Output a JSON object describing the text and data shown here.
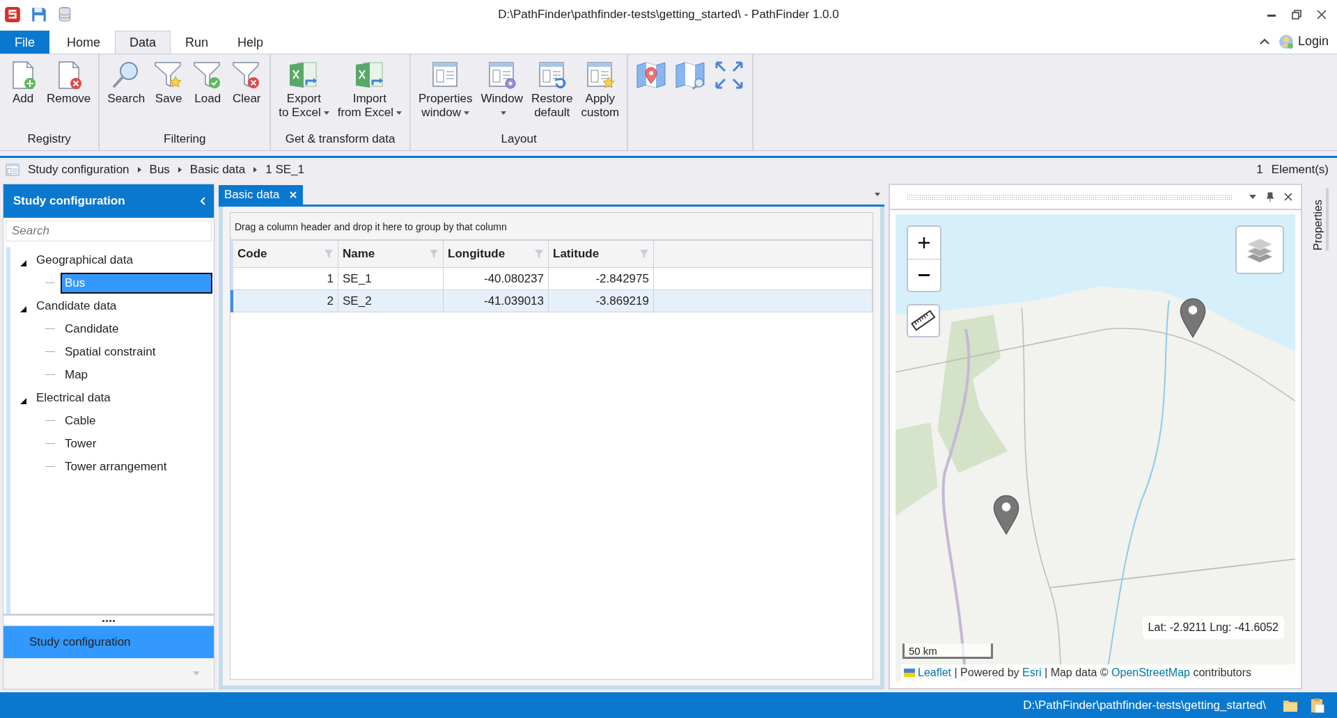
{
  "window": {
    "title": "D:\\PathFinder\\pathfinder-tests\\getting_started\\ - PathFinder 1.0.0"
  },
  "ribbon_tabs": [
    {
      "label": "File",
      "kind": "file",
      "selected": false
    },
    {
      "label": "Home",
      "kind": "tab",
      "selected": false
    },
    {
      "label": "Data",
      "kind": "tab",
      "selected": true
    },
    {
      "label": "Run",
      "kind": "tab",
      "selected": false
    },
    {
      "label": "Help",
      "kind": "tab",
      "selected": false
    }
  ],
  "login": "Login",
  "ribbon_groups": [
    {
      "label": "Registry",
      "buttons": [
        {
          "kind": "add",
          "lines": [
            "Add"
          ],
          "dropdown": false
        },
        {
          "kind": "remove",
          "lines": [
            "Remove"
          ],
          "dropdown": false
        }
      ]
    },
    {
      "label": "Filtering",
      "buttons": [
        {
          "kind": "search",
          "lines": [
            "Search"
          ],
          "dropdown": false
        },
        {
          "kind": "filter-save",
          "lines": [
            "Save"
          ],
          "dropdown": false
        },
        {
          "kind": "filter-load",
          "lines": [
            "Load"
          ],
          "dropdown": false
        },
        {
          "kind": "filter-clear",
          "lines": [
            "Clear"
          ],
          "dropdown": false
        }
      ]
    },
    {
      "label": "Get & transform data",
      "buttons": [
        {
          "kind": "export",
          "lines": [
            "Export",
            "to Excel"
          ],
          "dropdown": true
        },
        {
          "kind": "import",
          "lines": [
            "Import",
            "from Excel"
          ],
          "dropdown": true
        }
      ]
    },
    {
      "label": "Layout",
      "buttons": [
        {
          "kind": "properties",
          "lines": [
            "Properties",
            "window"
          ],
          "dropdown": true
        },
        {
          "kind": "window",
          "lines": [
            "Window"
          ],
          "dropdown": true
        },
        {
          "kind": "restore",
          "lines": [
            "Restore",
            "default"
          ],
          "dropdown": false
        },
        {
          "kind": "apply",
          "lines": [
            "Apply",
            "custom"
          ],
          "dropdown": false
        }
      ]
    },
    {
      "buttons": [
        {
          "kind": "map-pin"
        },
        {
          "kind": "map-search"
        },
        {
          "kind": "expand"
        }
      ]
    }
  ],
  "breadcrumb": [
    "Study configuration",
    "Bus",
    "Basic data",
    "1 SE_1"
  ],
  "element_count": "1",
  "element_label": "Element(s)",
  "sidebar": {
    "title": "Study configuration",
    "search": {
      "placeholder": "Search"
    },
    "tree": [
      {
        "label": "Geographical data",
        "expanded": true,
        "selected": false,
        "children": [
          {
            "label": "Bus",
            "selected": true
          }
        ]
      },
      {
        "label": "Candidate data",
        "expanded": true,
        "selected": false,
        "children": [
          {
            "label": "Candidate",
            "selected": false
          },
          {
            "label": "Spatial constraint",
            "selected": false
          },
          {
            "label": "Map",
            "selected": false
          }
        ]
      },
      {
        "label": "Electrical data",
        "expanded": true,
        "selected": false,
        "children": [
          {
            "label": "Cable",
            "selected": false
          },
          {
            "label": "Tower",
            "selected": false
          },
          {
            "label": "Tower arrangement",
            "selected": false
          }
        ]
      }
    ],
    "nav": [
      {
        "label": "Study configuration",
        "selected": true
      }
    ]
  },
  "document_tabs": [
    {
      "label": "Basic data",
      "selected": true
    }
  ],
  "group_panel_hint": "Drag a column header and drop it here to group by that column",
  "table": {
    "columns": [
      "Code",
      "Name",
      "Longitude",
      "Latitude"
    ],
    "rows": [
      {
        "cells": [
          "1",
          "SE_1",
          "-40.080237",
          "-2.842975"
        ],
        "selected": false
      },
      {
        "cells": [
          "2",
          "SE_2",
          "-41.039013",
          "-3.869219"
        ],
        "selected": true
      }
    ]
  },
  "map": {
    "scale": "50 km",
    "coordinates": "Lat: -2.9211 Lng: -41.6052",
    "attribution": [
      {
        "kind": "link",
        "text": "Leaflet"
      },
      {
        "kind": "text",
        "text": " | Powered by "
      },
      {
        "kind": "link",
        "text": "Esri"
      },
      {
        "kind": "text",
        "text": " | Map data © "
      },
      {
        "kind": "link",
        "text": "OpenStreetMap"
      },
      {
        "kind": "text",
        "text": " contributors"
      }
    ]
  },
  "side_tab": "Properties",
  "status_bar": {
    "path": "D:\\PathFinder\\pathfinder-tests\\getting_started\\"
  }
}
